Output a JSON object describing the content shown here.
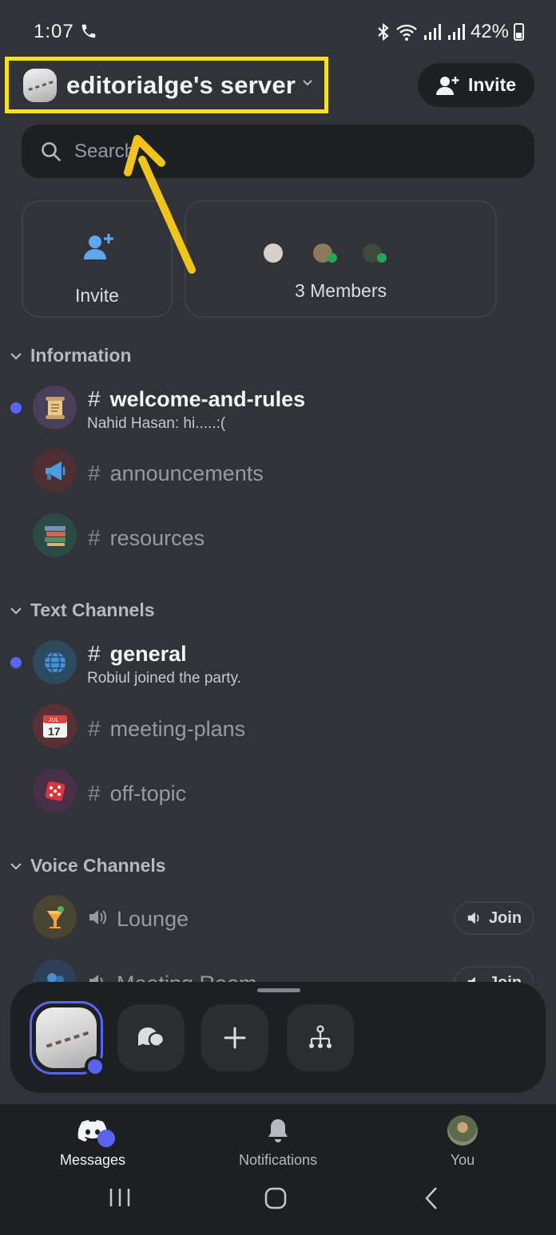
{
  "status_bar": {
    "time": "1:07",
    "battery": "42%"
  },
  "header": {
    "server_name": "editorialge's server",
    "invite_label": "Invite"
  },
  "search": {
    "placeholder": "Search"
  },
  "quick_cards": {
    "invite_label": "Invite",
    "members_label": "3 Members"
  },
  "categories": {
    "information": "Information",
    "text_channels": "Text Channels",
    "voice_channels": "Voice Channels"
  },
  "channels": {
    "welcome": {
      "name": "welcome-and-rules",
      "preview": "Nahid Hasan: hi.....:(",
      "icon": "scroll-icon"
    },
    "announcements": {
      "name": "announcements",
      "icon": "megaphone-icon"
    },
    "resources": {
      "name": "resources",
      "icon": "books-icon"
    },
    "general": {
      "name": "general",
      "preview": "Robiul joined the party.",
      "icon": "globe-icon"
    },
    "meeting_plans": {
      "name": "meeting-plans",
      "icon": "calendar-icon"
    },
    "off_topic": {
      "name": "off-topic",
      "icon": "dice-icon"
    }
  },
  "voice": {
    "lounge": {
      "name": "Lounge",
      "join_label": "Join",
      "icon": "tropical-drink-icon"
    },
    "meeting_room": {
      "name": "Meeting Room",
      "join_label": "Join",
      "icon": "people-icon"
    }
  },
  "calendar_icon_text": {
    "month": "JUL",
    "day": "17"
  },
  "bottom_nav": {
    "messages": "Messages",
    "notifications": "Notifications",
    "you": "You"
  },
  "colors": {
    "background": "#313338",
    "surface": "#1e1f22",
    "accent": "#5865f2",
    "highlight": "#f7e11b",
    "online": "#23a55a"
  }
}
